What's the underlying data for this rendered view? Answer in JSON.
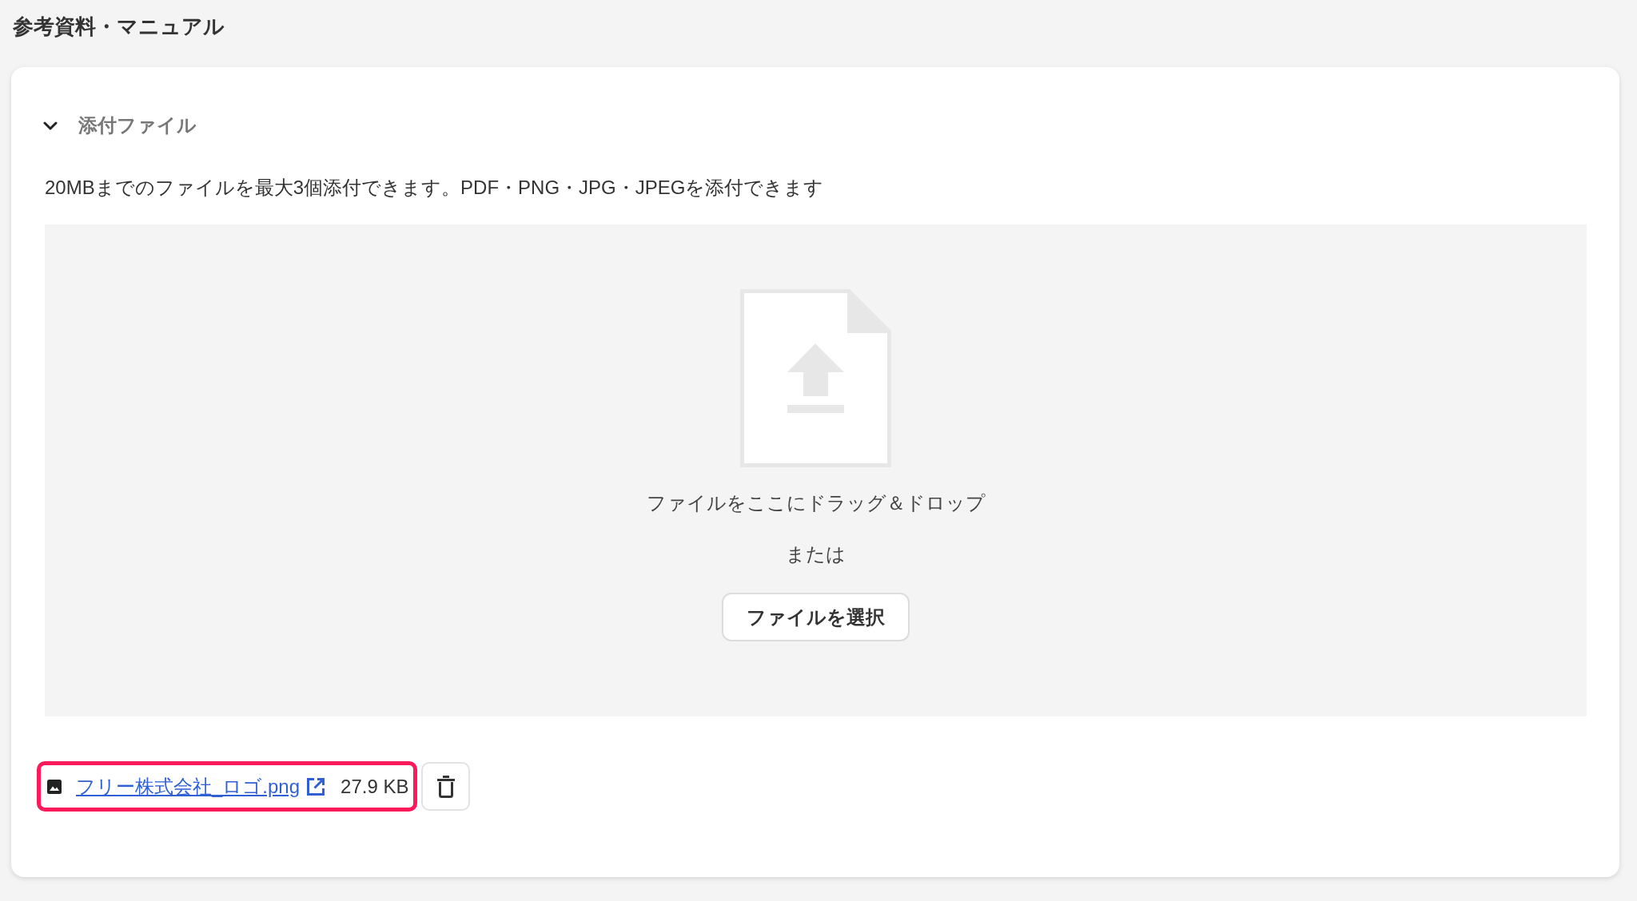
{
  "page": {
    "title": "参考資料・マニュアル"
  },
  "section": {
    "title": "添付ファイル",
    "expanded": true,
    "description": "20MBまでのファイルを最大3個添付できます。PDF・PNG・JPG・JPEGを添付できます",
    "dropzone": {
      "prompt": "ファイルをここにドラッグ＆ドロップ",
      "separator": "または",
      "button": "ファイルを選択"
    },
    "attachments": [
      {
        "kind": "image",
        "name": "フリー株式会社_ロゴ.png",
        "size": "27.9 KB",
        "highlighted": true
      }
    ]
  }
}
